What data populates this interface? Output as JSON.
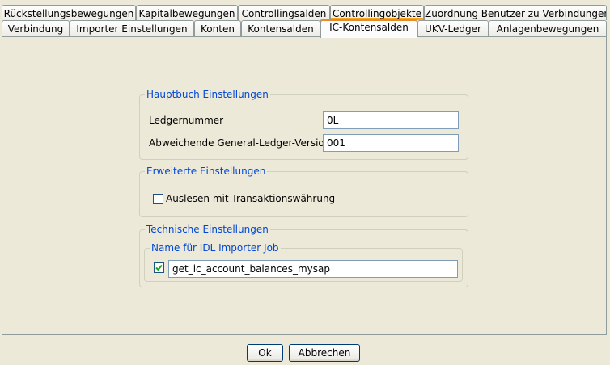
{
  "tabs": {
    "row1": [
      "Rückstellungsbewegungen",
      "Kapitalbewegungen",
      "Controllingsalden",
      "Controllingobjekte",
      "Zuordnung Benutzer zu Verbindungen"
    ],
    "row2": [
      "Verbindung",
      "Importer Einstellungen",
      "Konten",
      "Kontensalden",
      "IC-Kontensalden",
      "UKV-Ledger",
      "Anlagenbewegungen"
    ],
    "active": "IC-Kontensalden"
  },
  "hauptbuch": {
    "legend": "Hauptbuch Einstellungen",
    "ledgernummer_label": "Ledgernummer",
    "ledgernummer_value": "0L",
    "gl_version_label": "Abweichende General-Ledger-Version",
    "gl_version_value": "001"
  },
  "erweitert": {
    "legend": "Erweiterte Einstellungen",
    "transaktion_label": "Auslesen mit Transaktionswährung",
    "transaktion_checked": false
  },
  "technisch": {
    "legend": "Technische Einstellungen",
    "idl_legend": "Name für IDL Importer Job",
    "idl_checked": true,
    "idl_value": "get_ic_account_balances_mysap"
  },
  "buttons": {
    "ok": "Ok",
    "cancel": "Abbrechen"
  }
}
